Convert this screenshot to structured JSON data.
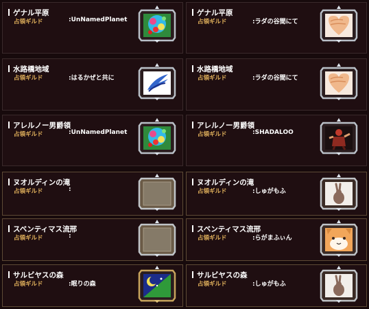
{
  "guild_label": "占領ギルド",
  "colon_prefix": ":",
  "cells": [
    {
      "area": "ゲナル平原",
      "guild": "UnNamedPlanet",
      "emblem": "planet-emblem"
    },
    {
      "area": "ゲナル平原",
      "guild": "ラダの谷間にて",
      "emblem": "heart-emblem"
    },
    {
      "area": "水路橋地域",
      "guild": "はるかぜと共に",
      "emblem": "wing-emblem"
    },
    {
      "area": "水路橋地域",
      "guild": "ラダの谷間にて",
      "emblem": "heart-emblem"
    },
    {
      "area": "アレルノー男爵領",
      "guild": "UnNamedPlanet",
      "emblem": "planet-emblem"
    },
    {
      "area": "アレルノー男爵領",
      "guild": "SHADALOO",
      "emblem": "fighter-emblem"
    },
    {
      "area": "ヌオルディンの滝",
      "guild": "",
      "emblem": "empty-emblem"
    },
    {
      "area": "ヌオルディンの滝",
      "guild": "しゅがもふ",
      "emblem": "rabbit-emblem"
    },
    {
      "area": "スベンティマス流邢",
      "guild": "",
      "emblem": "empty-emblem"
    },
    {
      "area": "スベンティマス流邢",
      "guild": "らがまふぃん",
      "emblem": "cat-emblem"
    },
    {
      "area": "サルビヤスの森",
      "guild": "眠りの森",
      "emblem": "moon-emblem"
    },
    {
      "area": "サルビヤスの森",
      "guild": "しゅがもふ",
      "emblem": "rabbit-emblem"
    }
  ],
  "colors": {
    "background": "#170a0c",
    "panel": "#1f0e11",
    "label_gold": "#e1b15c",
    "frame_silver": "#b9c0c8",
    "frame_gold": "#c8a45c"
  }
}
